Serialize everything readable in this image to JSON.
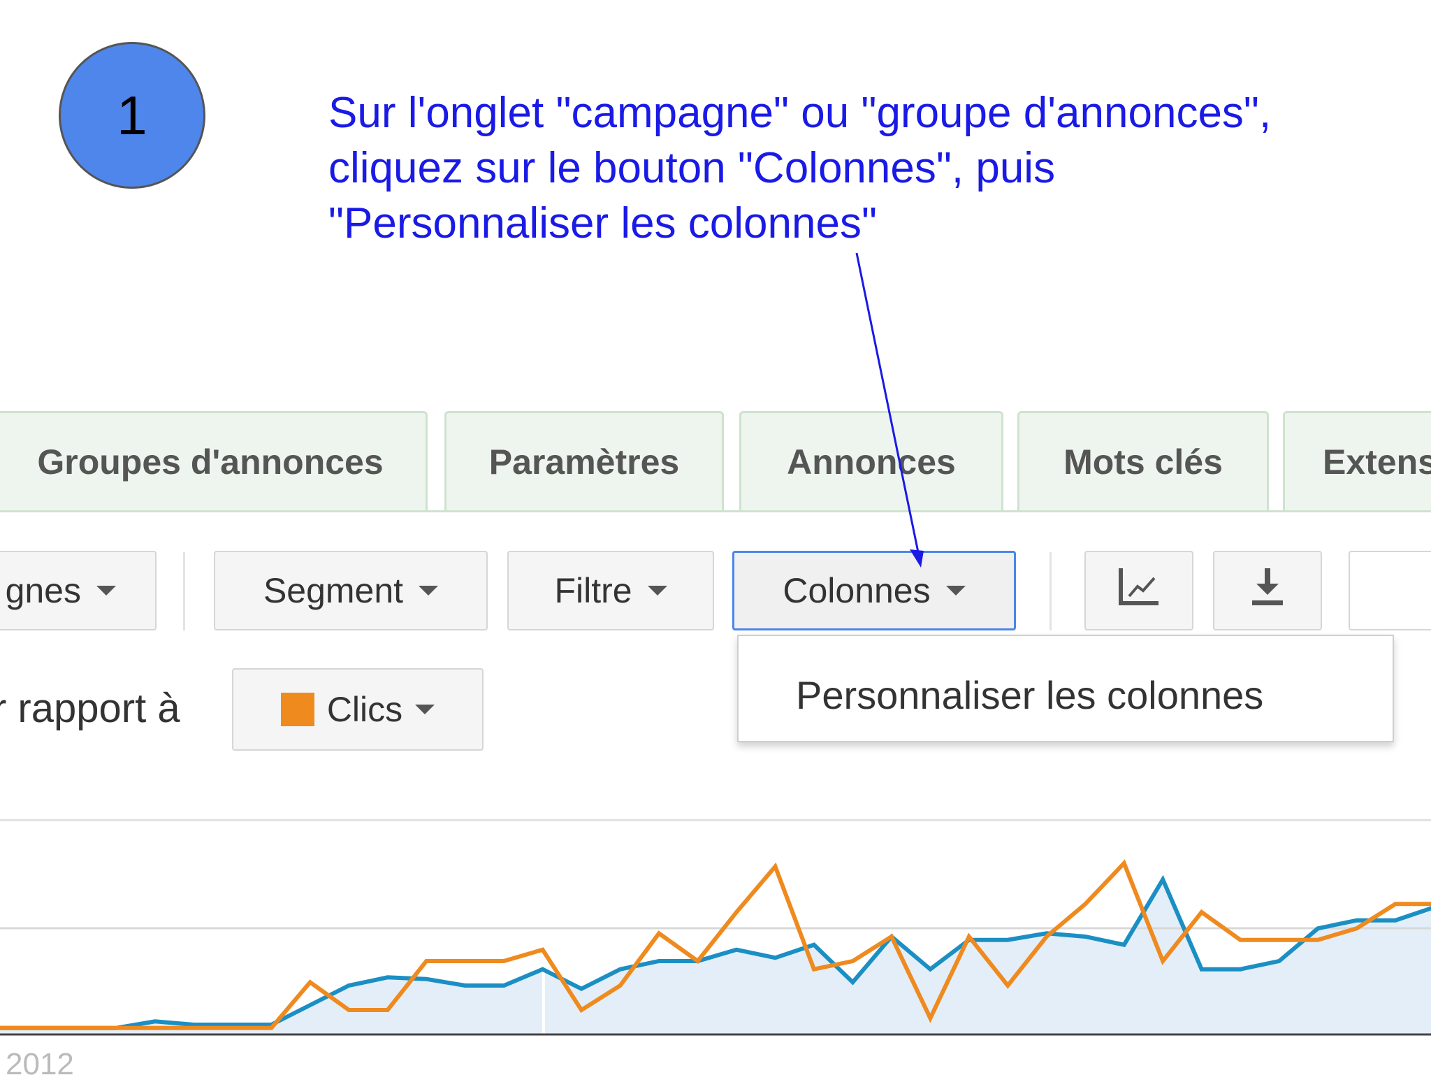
{
  "step": {
    "number": "1"
  },
  "instruction": {
    "lines": [
      "Sur l'onglet \"campagne\" ou \"groupe d'annonces\",",
      "cliquez sur le bouton \"Colonnes\", puis",
      "\"Personnaliser les colonnes\""
    ]
  },
  "tabs": [
    {
      "label": "Groupes d'annonces"
    },
    {
      "label": "Paramètres"
    },
    {
      "label": "Annonces"
    },
    {
      "label": "Mots clés"
    },
    {
      "label": "Extens"
    }
  ],
  "toolbar": {
    "campaigns_label": "gnes",
    "segment_label": "Segment",
    "filter_label": "Filtre",
    "columns_label": "Colonnes",
    "chart_icon": "line-chart-icon",
    "download_icon": "download-icon"
  },
  "columns_dropdown": {
    "items": [
      {
        "label": "Personnaliser les colonnes"
      }
    ]
  },
  "compare": {
    "label": "r rapport à",
    "metric_label": "Clics",
    "metric_color": "#ef8a1f"
  },
  "chart": {
    "year_label": "2012"
  },
  "chart_data": {
    "type": "line",
    "series": [
      {
        "color": "#1b8fc4",
        "fill": "#e3eef8",
        "values": [
          4,
          4,
          4,
          4,
          8,
          6,
          6,
          6,
          18,
          30,
          35,
          34,
          30,
          30,
          40,
          28,
          40,
          45,
          45,
          52,
          47,
          55,
          32,
          60,
          40,
          58,
          58,
          62,
          60,
          55,
          95,
          40,
          40,
          45,
          65,
          70,
          70,
          78,
          78
        ]
      },
      {
        "color": "#ef8a1f",
        "values": [
          4,
          4,
          4,
          4,
          4,
          4,
          4,
          4,
          32,
          15,
          15,
          45,
          45,
          45,
          52,
          15,
          30,
          62,
          45,
          75,
          103,
          40,
          45,
          60,
          10,
          60,
          30,
          60,
          80,
          105,
          45,
          75,
          58,
          58,
          58,
          65,
          80,
          80,
          85
        ]
      }
    ],
    "ylim": [
      0,
      120
    ]
  },
  "colors": {
    "accent_text": "#1a1ae6",
    "step_circle": "#4f86ec",
    "active_border": "#4a86e8"
  }
}
